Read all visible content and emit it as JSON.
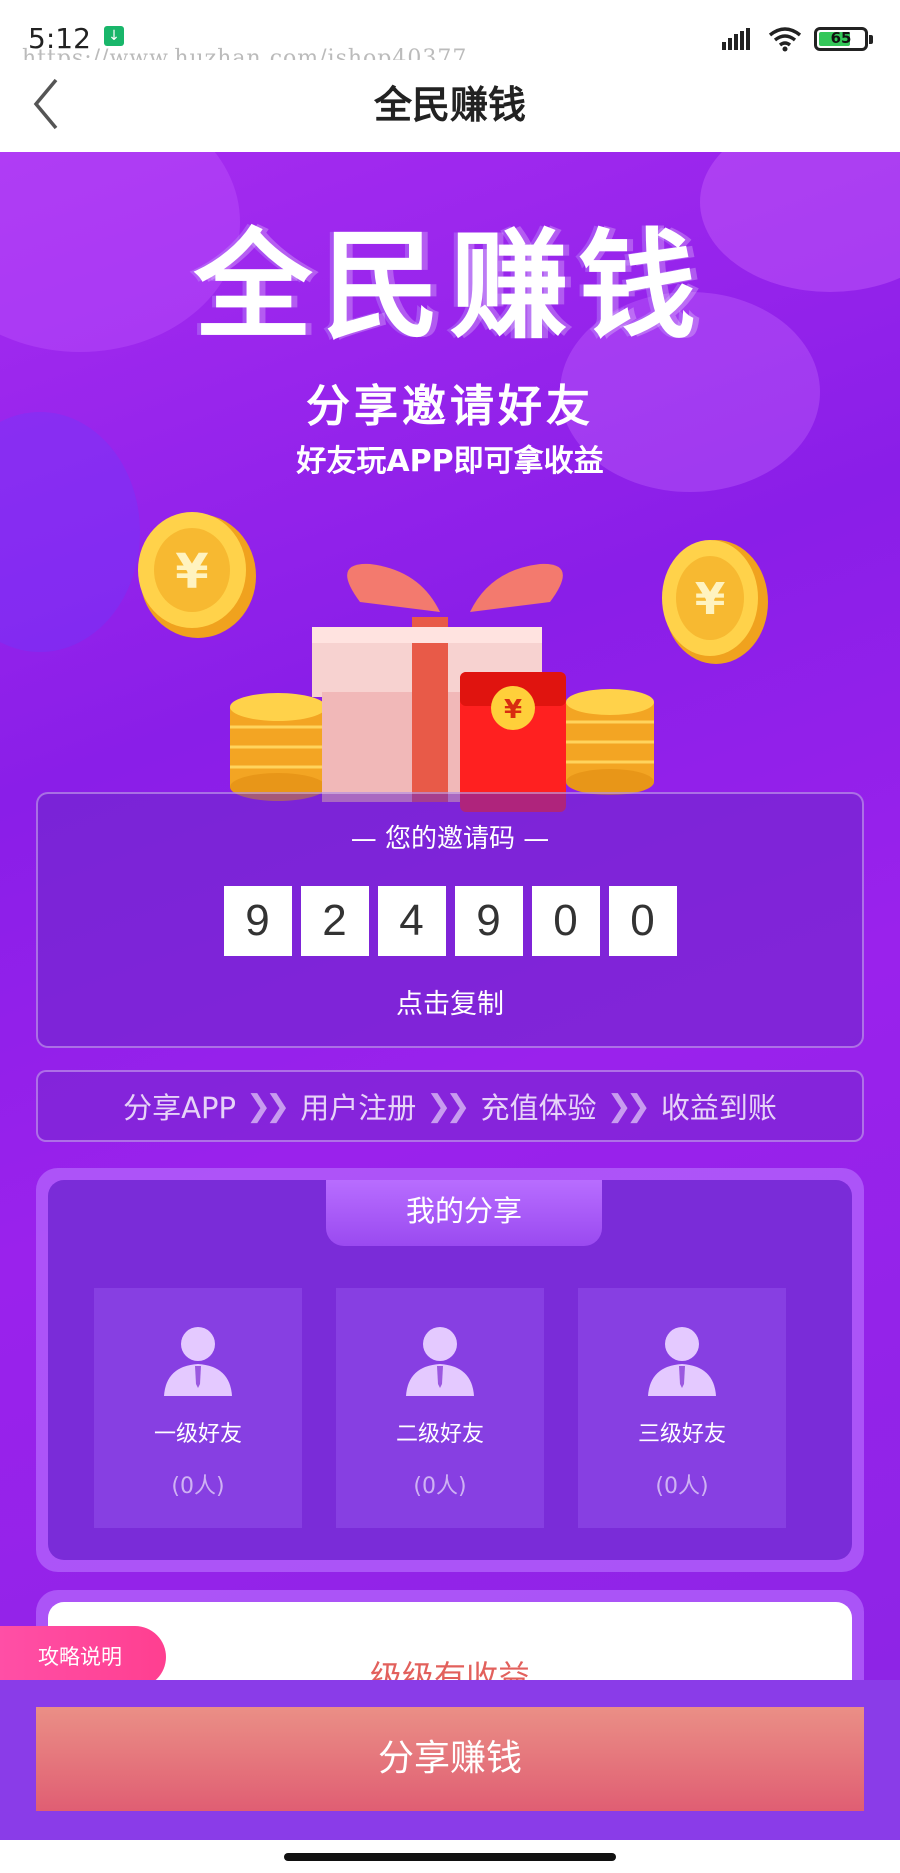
{
  "status_bar": {
    "time": "5:12",
    "watermark": "https://www.huzhan.com/ishop40377",
    "battery": "65",
    "icons": [
      "download-icon",
      "signal-icon",
      "wifi-icon",
      "battery-icon"
    ]
  },
  "header": {
    "title": "全民赚钱",
    "back_icon": "chevron-left-icon"
  },
  "hero": {
    "title": "全民赚钱",
    "subtitle": "分享邀请好友",
    "subtitle2": "好友玩APP即可拿收益"
  },
  "invite": {
    "label": "— 您的邀请码 —",
    "digits": [
      "9",
      "2",
      "4",
      "9",
      "0",
      "0"
    ],
    "copy_label": "点击复制"
  },
  "steps": [
    "分享APP",
    "用户注册",
    "充值体验",
    "收益到账"
  ],
  "share": {
    "tab_label": "我的分享",
    "friends": [
      {
        "label": "一级好友",
        "count": "(0人)"
      },
      {
        "label": "二级好友",
        "count": "(0人)"
      },
      {
        "label": "三级好友",
        "count": "(0人)"
      }
    ]
  },
  "strategy": {
    "badge": "攻略说明",
    "heading": "级级有收益"
  },
  "bottom": {
    "share_button": "分享赚钱"
  },
  "colors": {
    "purple": "#8a1ee8",
    "button": "#e05e73",
    "badge": "#ff3f90"
  }
}
